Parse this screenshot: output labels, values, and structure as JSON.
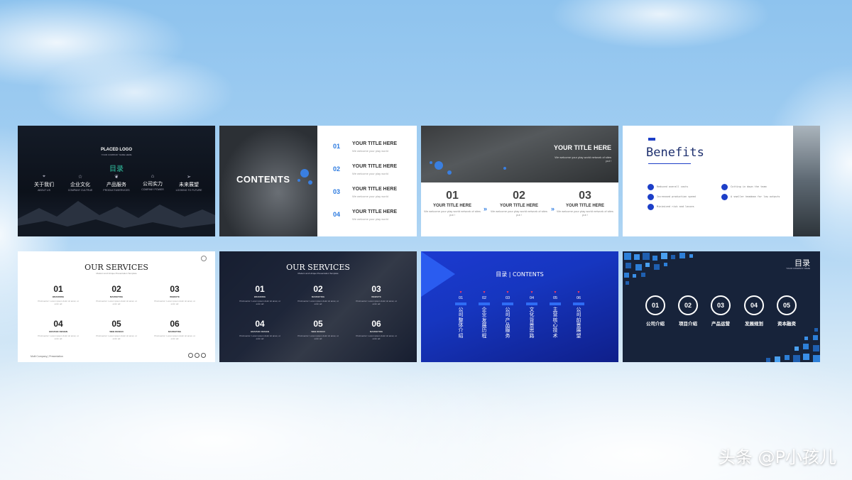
{
  "slides": {
    "s1": {
      "logo": "PLACED LOGO",
      "logo_sub": "YOUR COMPANY NAME HERE",
      "title": "目录",
      "items": [
        {
          "icon": "location-icon",
          "label": "关于我们",
          "en": "ABOUT US"
        },
        {
          "icon": "star-icon",
          "label": "企业文化",
          "en": "COMPANY CULTRUE"
        },
        {
          "icon": "leaf-icon",
          "label": "产品服务",
          "en": "PRODUCT&SERVICES"
        },
        {
          "icon": "house-icon",
          "label": "公司实力",
          "en": "COMPANY POWER"
        },
        {
          "icon": "paper-plane-icon",
          "label": "未来展望",
          "en": "LOOKING TO FUTURE"
        }
      ]
    },
    "s2": {
      "heading": "CONTENTS",
      "items": [
        {
          "num": "01",
          "title": "YOUR TITLE HERE",
          "sub": "We welcome your play world"
        },
        {
          "num": "02",
          "title": "YOUR TITLE HERE",
          "sub": "We welcome your play world"
        },
        {
          "num": "03",
          "title": "YOUR TITLE HERE",
          "sub": "We welcome your play world"
        },
        {
          "num": "04",
          "title": "YOUR TITLE HERE",
          "sub": "We welcome your play world"
        }
      ]
    },
    "s3": {
      "header_title": "YOUR TITLE HERE",
      "header_sub": "We welcome your play world network of sites put !",
      "cols": [
        {
          "num": "01",
          "title": "YOUR TITLE HERE",
          "sub": "We welcome your play world network of sites put !"
        },
        {
          "num": "02",
          "title": "YOUR TITLE HERE",
          "sub": "We welcome your play world network of sites put !"
        },
        {
          "num": "03",
          "title": "YOUR TITLE HERE",
          "sub": "We welcome your play world network of sites put !"
        }
      ],
      "arrow": "»"
    },
    "s4": {
      "title": "Benefits",
      "items": [
        "Reduced overall costs",
        "Increased production speed",
        "Minimized risk and losses",
        "Cutting in down the team",
        "A smaller headman for low outputs"
      ]
    },
    "s5": {
      "title": "OUR SERVICES",
      "subtitle": "Modern and Unique Presentation Template",
      "items": [
        {
          "num": "01",
          "label": "BRANDING",
          "text": "Proinventor: Lorem ipsum dolor sit amet, ut enim ad"
        },
        {
          "num": "02",
          "label": "MARKETING",
          "text": "Proinventor: Lorem ipsum dolor sit amet, ut enim ad"
        },
        {
          "num": "03",
          "label": "WEBSITE",
          "text": "Proinventor: Lorem ipsum dolor sit amet, ut enim ad"
        },
        {
          "num": "04",
          "label": "GRAPHIC DESIGN",
          "text": "Proinventor: Lorem ipsum dolor sit amet, ut enim ad"
        },
        {
          "num": "05",
          "label": "WEB DESIGN",
          "text": "Proinventor: Lorem ipsum dolor sit amet, ut enim ad"
        },
        {
          "num": "06",
          "label": "MARKETING",
          "text": "Proinventor: Lorem ipsum dolor sit amet, ut enim ad"
        }
      ],
      "footer": "Multi Company | Presentation"
    },
    "s6": {
      "title": "OUR SERVICES",
      "subtitle": "Modern and Unique Presentation Template",
      "items": [
        {
          "num": "01",
          "label": "BRANDING",
          "text": "Proinventor: Lorem ipsum dolor sit amet, ut enim ad"
        },
        {
          "num": "02",
          "label": "MARKETING",
          "text": "Proinventor: Lorem ipsum dolor sit amet, ut enim ad"
        },
        {
          "num": "03",
          "label": "WEBSITE",
          "text": "Proinventor: Lorem ipsum dolor sit amet, ut enim ad"
        },
        {
          "num": "04",
          "label": "GRAPHIC DESIGN",
          "text": "Proinventor: Lorem ipsum dolor sit amet, ut enim ad"
        },
        {
          "num": "05",
          "label": "WEB DESIGN",
          "text": "Proinventor: Lorem ipsum dolor sit amet, ut enim ad"
        },
        {
          "num": "06",
          "label": "MARKETING",
          "text": "Proinventor: Lorem ipsum dolor sit amet, ut enim ad"
        }
      ]
    },
    "s7": {
      "heading": "目录 | CONTENTS",
      "items": [
        {
          "num": "01",
          "label": "公司整体介绍"
        },
        {
          "num": "02",
          "label": "企业发展历程"
        },
        {
          "num": "03",
          "label": "公司产品服务"
        },
        {
          "num": "04",
          "label": "文化背景思路"
        },
        {
          "num": "05",
          "label": "主营核心技术"
        },
        {
          "num": "06",
          "label": "公司前景展望"
        }
      ],
      "marker": "▼"
    },
    "s8": {
      "title": "目录",
      "subtitle": "YOUR COMPANY NAME",
      "items": [
        {
          "num": "01",
          "label": "公司介绍"
        },
        {
          "num": "02",
          "label": "项目介绍"
        },
        {
          "num": "03",
          "label": "产品运营"
        },
        {
          "num": "04",
          "label": "发展规划"
        },
        {
          "num": "05",
          "label": "资本融资"
        }
      ]
    }
  },
  "watermark": "头条 @P小孩儿",
  "colors": {
    "accent_blue": "#2d7be0",
    "benefits_blue": "#1d3fc8",
    "contents_bg": "#1c3ad0",
    "teal": "#30c0a0"
  }
}
